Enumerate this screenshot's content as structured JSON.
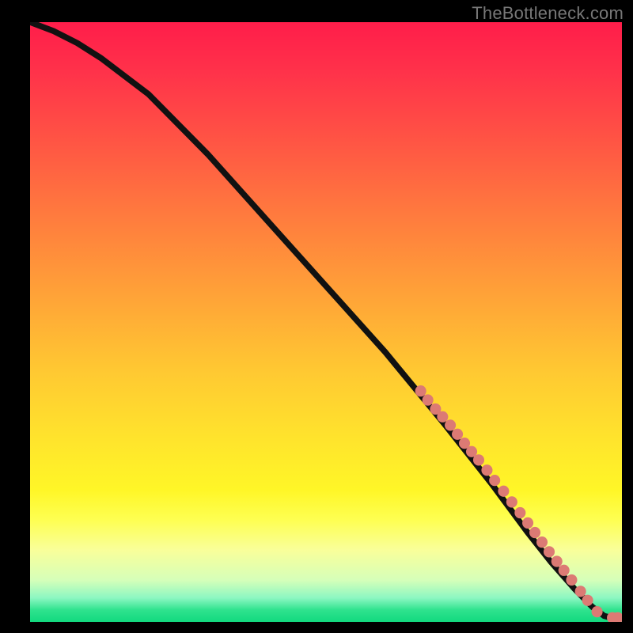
{
  "attribution": "TheBottleneck.com",
  "chart_data": {
    "type": "line",
    "title": "",
    "xlabel": "",
    "ylabel": "",
    "xlim": [
      0,
      100
    ],
    "ylim": [
      0,
      100
    ],
    "curve": {
      "x": [
        0,
        4,
        8,
        12,
        20,
        30,
        40,
        50,
        60,
        70,
        78,
        84,
        88,
        92,
        95,
        97,
        98.5,
        100
      ],
      "y": [
        100,
        98.5,
        96.5,
        94,
        88,
        78,
        67,
        56,
        45,
        33,
        23,
        15,
        10,
        5.5,
        2.5,
        1,
        0.6,
        0.6
      ]
    },
    "markers": {
      "xy": [
        [
          66,
          38.5
        ],
        [
          67.2,
          37
        ],
        [
          68.5,
          35.5
        ],
        [
          69.7,
          34.2
        ],
        [
          71,
          32.8
        ],
        [
          72.2,
          31.3
        ],
        [
          73.4,
          29.8
        ],
        [
          74.6,
          28.4
        ],
        [
          75.8,
          27
        ],
        [
          77.2,
          25.3
        ],
        [
          78.5,
          23.6
        ],
        [
          80,
          21.8
        ],
        [
          81.4,
          20
        ],
        [
          82.8,
          18.2
        ],
        [
          84.1,
          16.5
        ],
        [
          85.3,
          14.9
        ],
        [
          86.5,
          13.3
        ],
        [
          87.7,
          11.7
        ],
        [
          89,
          10.1
        ],
        [
          90.2,
          8.6
        ],
        [
          91.5,
          7
        ],
        [
          93,
          5.1
        ],
        [
          94.2,
          3.6
        ],
        [
          95.8,
          1.7
        ],
        [
          98.4,
          0.7
        ],
        [
          99.3,
          0.7
        ]
      ],
      "color": "#dc7a74",
      "radius": 7
    }
  }
}
